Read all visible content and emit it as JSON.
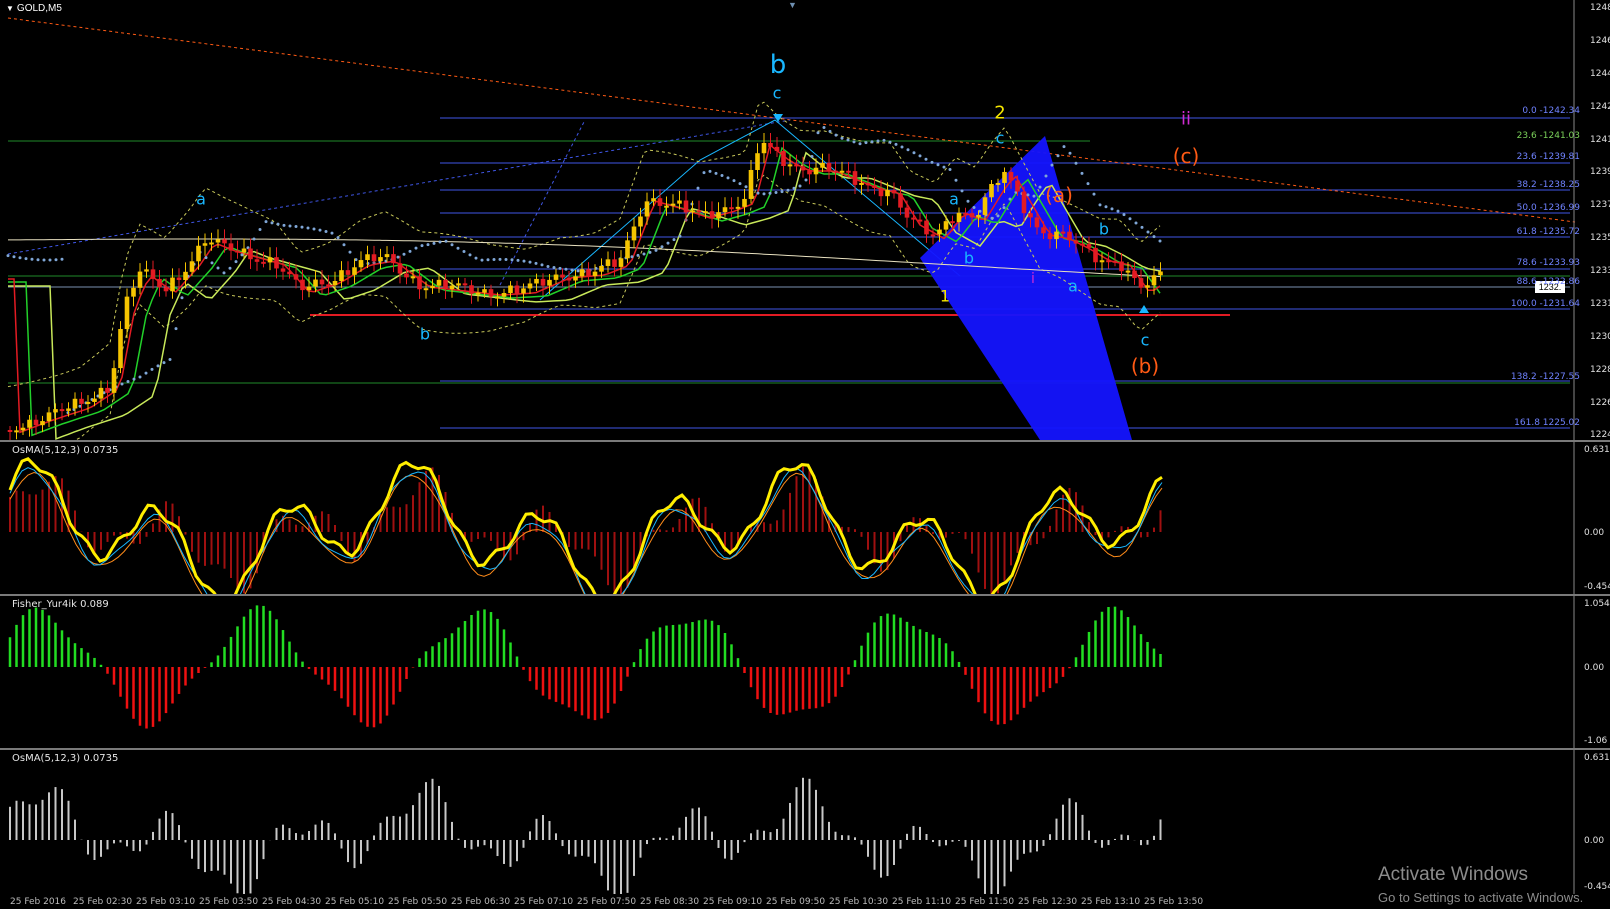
{
  "window": {
    "title": "GOLD,M5"
  },
  "main_chart": {
    "price_axis": [
      "1248.",
      "1246.",
      "1244.",
      "1242.",
      "1241.",
      "1239.",
      "1237.",
      "1235.",
      "1233.",
      "1231.",
      "1230.",
      "1228.",
      "1226.",
      "1224."
    ],
    "current_price": "1232.",
    "fibo_levels_upper": [
      "0.0 -1242.34",
      "23.6 -1241.03",
      "23.6 -1239.81",
      "38.2 -1238.25",
      "50.0 -1236.99",
      "61.8 -1235.72",
      "78.6 -1233.93",
      "88.6 -1232.86",
      "100.0 -1231.64"
    ],
    "fibo_levels_lower": [
      "138.2 -1227.55",
      "161.8 1225.02"
    ],
    "wave_labels": {
      "b_major": "b",
      "c_top": "c",
      "a_left": "a",
      "b_left": "b",
      "two": "2",
      "c_mid": "c",
      "a_mid": "a",
      "b_mid": "b",
      "one": "1",
      "ii": "ii",
      "c_paren": "(c)",
      "a_paren": "(a)",
      "b_right": "b",
      "a_right": "a",
      "i": "i",
      "c_bottom": "c",
      "b_paren": "(b)"
    },
    "colors": {
      "bull_candle": "#f5c400",
      "bear_candle": "#e31b23",
      "fast_ma": "#e31b23",
      "mid_ma": "#22d02a",
      "slow_ma": "#c8e85a",
      "fibo_line": "#3f56e6",
      "wedge": "#1414ff",
      "wave_cyan": "#19b7ff",
      "wave_yellow": "#f5e600",
      "wave_orange": "#ff5a14",
      "wave_magenta": "#cf2bd1"
    }
  },
  "osma_pane": {
    "title": "OsMA(5,12,3) 0.0735",
    "axis": [
      "0.631",
      "0.00",
      "-0.454"
    ]
  },
  "fisher_pane": {
    "title": "Fisher_Yur4ik 0.089",
    "axis": [
      "1.054",
      "0.00",
      "-1.06"
    ]
  },
  "osma2_pane": {
    "title": "OsMA(5,12,3) 0.0735",
    "axis": [
      "0.631",
      "0.00",
      "-0.454"
    ]
  },
  "time_axis": [
    "25 Feb 2016",
    "25 Feb 02:30",
    "25 Feb 03:10",
    "25 Feb 03:50",
    "25 Feb 04:30",
    "25 Feb 05:10",
    "25 Feb 05:50",
    "25 Feb 06:30",
    "25 Feb 07:10",
    "25 Feb 07:50",
    "25 Feb 08:30",
    "25 Feb 09:10",
    "25 Feb 09:50",
    "25 Feb 10:30",
    "25 Feb 11:10",
    "25 Feb 11:50",
    "25 Feb 12:30",
    "25 Feb 13:10",
    "25 Feb 13:50"
  ],
  "watermark": {
    "line1": "Activate Windows",
    "line2": "Go to Settings to activate Windows."
  }
}
